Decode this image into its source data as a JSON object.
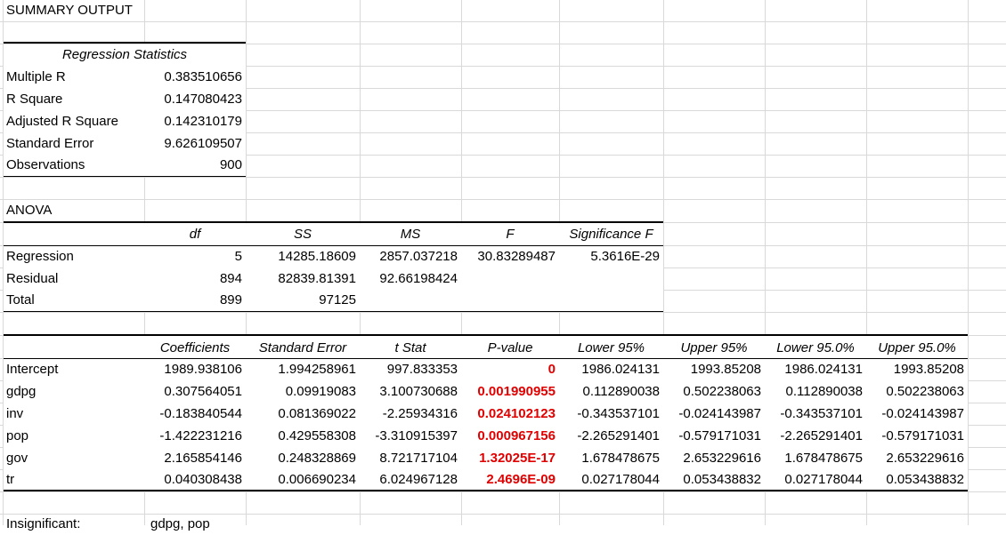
{
  "title": "SUMMARY OUTPUT",
  "regression_statistics": {
    "header": "Regression Statistics",
    "rows": [
      {
        "label": "Multiple R",
        "value": "0.383510656"
      },
      {
        "label": "R Square",
        "value": "0.147080423"
      },
      {
        "label": "Adjusted R Square",
        "value": "0.142310179"
      },
      {
        "label": "Standard Error",
        "value": "9.626109507"
      },
      {
        "label": "Observations",
        "value": "900"
      }
    ]
  },
  "anova": {
    "title": "ANOVA",
    "headers": [
      "df",
      "SS",
      "MS",
      "F",
      "Significance F"
    ],
    "rows": [
      {
        "label": "Regression",
        "cells": [
          "5",
          "14285.18609",
          "2857.037218",
          "30.83289487",
          "5.3616E-29"
        ]
      },
      {
        "label": "Residual",
        "cells": [
          "894",
          "82839.81391",
          "92.66198424",
          "",
          ""
        ]
      },
      {
        "label": "Total",
        "cells": [
          "899",
          "97125",
          "",
          "",
          ""
        ]
      }
    ]
  },
  "coefficients": {
    "headers": [
      "Coefficients",
      "Standard Error",
      "t Stat",
      "P-value",
      "Lower 95%",
      "Upper 95%",
      "Lower 95.0%",
      "Upper 95.0%"
    ],
    "rows": [
      {
        "label": "Intercept",
        "cells": [
          "1989.938106",
          "1.994258961",
          "997.833353",
          "0",
          "1986.024131",
          "1993.85208",
          "1986.024131",
          "1993.85208"
        ]
      },
      {
        "label": "gdpg",
        "cells": [
          "0.307564051",
          "0.09919083",
          "3.100730688",
          "0.001990955",
          "0.112890038",
          "0.502238063",
          "0.112890038",
          "0.502238063"
        ]
      },
      {
        "label": "inv",
        "cells": [
          "-0.183840544",
          "0.081369022",
          "-2.25934316",
          "0.024102123",
          "-0.343537101",
          "-0.024143987",
          "-0.343537101",
          "-0.024143987"
        ]
      },
      {
        "label": "pop",
        "cells": [
          "-1.422231216",
          "0.429558308",
          "-3.310915397",
          "0.000967156",
          "-2.265291401",
          "-0.579171031",
          "-2.265291401",
          "-0.579171031"
        ]
      },
      {
        "label": "gov",
        "cells": [
          "2.165854146",
          "0.248328869",
          "8.721717104",
          "1.32025E-17",
          "1.678478675",
          "2.653229616",
          "1.678478675",
          "2.653229616"
        ]
      },
      {
        "label": "tr",
        "cells": [
          "0.040308438",
          "0.006690234",
          "6.024967128",
          "2.4696E-09",
          "0.027178044",
          "0.053438832",
          "0.027178044",
          "0.053438832"
        ]
      }
    ]
  },
  "footer_partial": {
    "label": "Insignificant:",
    "value": "gdpg, pop"
  },
  "colors": {
    "gridline": "#d9d9d9",
    "highlight": "#e00000",
    "text": "#000000"
  }
}
